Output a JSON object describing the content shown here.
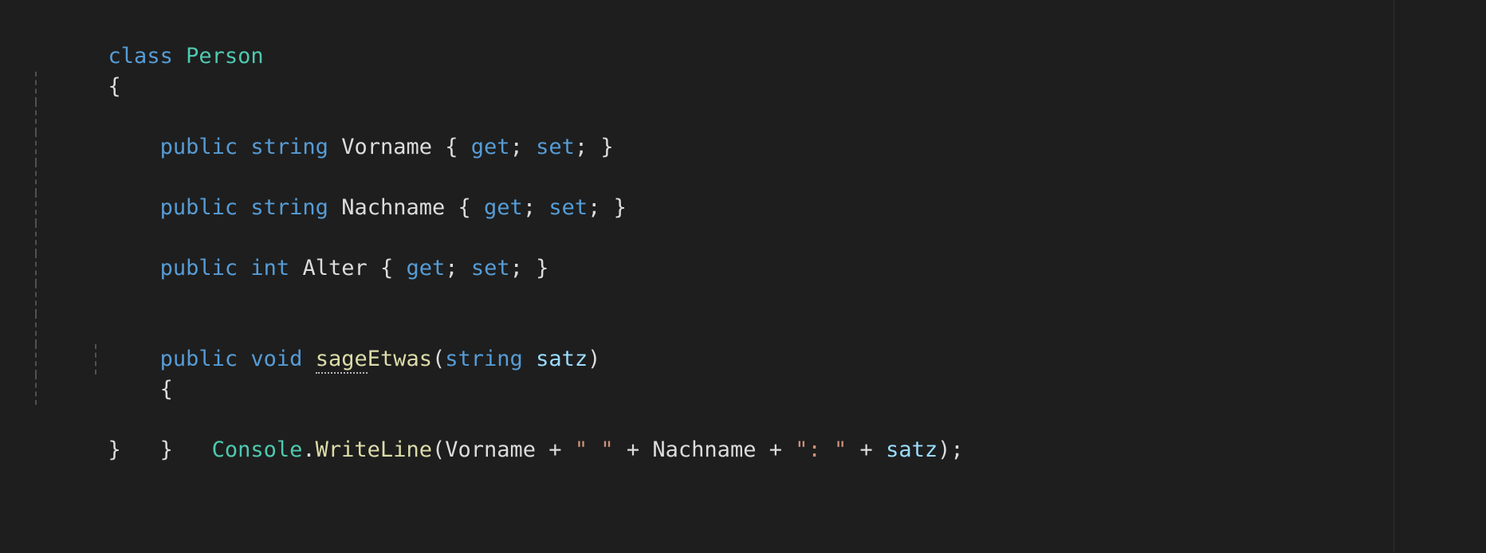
{
  "editor": {
    "language": "csharp",
    "background_color": "#1e1e1e",
    "default_text_color": "#d4d4d4",
    "indent_guide_color": "#5a5a5a",
    "divider_color": "#2f2f2f",
    "theme_colors": {
      "keyword": "#569cd6",
      "type": "#4ec9b0",
      "identifier": "#dcdcdc",
      "method": "#dcdcaa",
      "parameter": "#9cdcfe",
      "string": "#ce9178",
      "punctuation": "#dcdcdc"
    }
  },
  "code": {
    "lines": [
      {
        "indent": 0,
        "guides": 0,
        "text": "class Person"
      },
      {
        "indent": 0,
        "guides": 0,
        "text": "{"
      },
      {
        "indent": 1,
        "guides": 1,
        "text": "    public string Vorname { get; set; }"
      },
      {
        "indent": 1,
        "guides": 1,
        "text": ""
      },
      {
        "indent": 1,
        "guides": 1,
        "text": "    public string Nachname { get; set; }"
      },
      {
        "indent": 1,
        "guides": 1,
        "text": ""
      },
      {
        "indent": 1,
        "guides": 1,
        "text": "    public int Alter { get; set; }"
      },
      {
        "indent": 1,
        "guides": 1,
        "text": ""
      },
      {
        "indent": 1,
        "guides": 1,
        "text": ""
      },
      {
        "indent": 1,
        "guides": 1,
        "text": "    public void sageEtwas(string satz)"
      },
      {
        "indent": 1,
        "guides": 1,
        "text": "    {"
      },
      {
        "indent": 2,
        "guides": 2,
        "text": "        Console.WriteLine(Vorname + \" \" + Nachname + \": \" + satz);"
      },
      {
        "indent": 1,
        "guides": 1,
        "text": "    }"
      },
      {
        "indent": 0,
        "guides": 0,
        "text": "}"
      }
    ]
  },
  "tokens": {
    "kw_class": "class",
    "type_person": "Person",
    "brace_open": "{",
    "brace_close": "}",
    "kw_public": "public",
    "kw_string": "string",
    "kw_int": "int",
    "kw_void": "void",
    "kw_get": "get",
    "kw_set": "set",
    "semicolon": ";",
    "prop_vorname": "Vorname",
    "prop_nachname": "Nachname",
    "prop_alter": "Alter",
    "method_sage_etwas_misspelled": "sage",
    "method_sage_etwas_rest": "Etwas",
    "paren_open": "(",
    "paren_close": ")",
    "param_satz": "satz",
    "type_console": "Console",
    "dot": ".",
    "method_writeline": "WriteLine",
    "plus": "+",
    "str_space": "\" \"",
    "str_colon": "\": \"",
    "space": " "
  }
}
